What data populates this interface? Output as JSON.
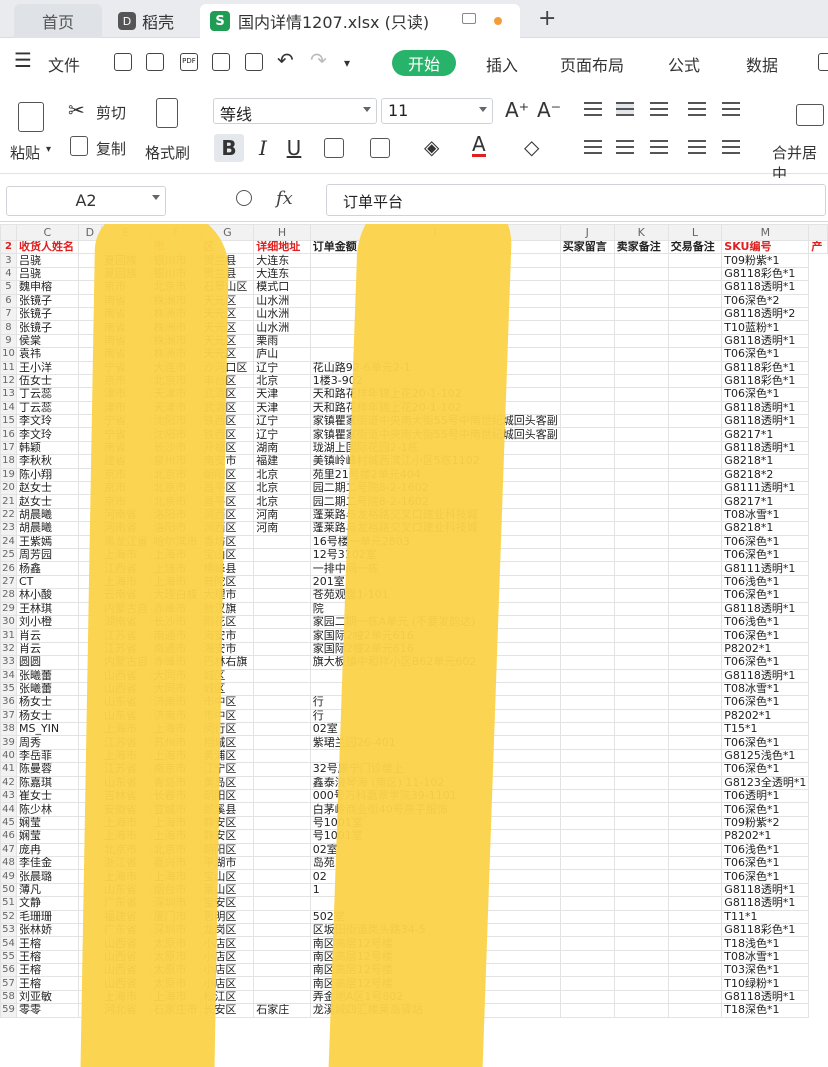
{
  "tabs": {
    "home": "首页",
    "docer": "稻壳",
    "file": "国内详情1207.xlsx (只读)",
    "new": "+"
  },
  "menu": {
    "file": "文件",
    "start": "开始",
    "insert": "插入",
    "layout": "页面布局",
    "formula": "公式",
    "data": "数据"
  },
  "ribbon": {
    "cut": "剪切",
    "copy": "复制",
    "paste": "粘贴",
    "format_painter": "格式刷",
    "font": "等线",
    "size": "11",
    "merge": "合并居中",
    "bold": "B",
    "italic": "I",
    "underline": "U"
  },
  "formula": {
    "cell": "A2",
    "fx": "fx",
    "value": "订单平台"
  },
  "columns": [
    "C",
    "D",
    "E",
    "F",
    "G",
    "H",
    "I",
    "J",
    "K",
    "L",
    "M",
    ""
  ],
  "header": [
    "收货人姓名",
    "",
    "",
    "市",
    "区",
    "详细地址",
    "订单金额",
    "买家留言",
    "卖家备注",
    "交易备注",
    "SKU编号",
    "产"
  ],
  "rows": [
    [
      "3",
      "吕骁",
      "",
      "夏回族",
      "银川市",
      "贺兰县",
      "大连东",
      "",
      "",
      "",
      "",
      "T09粉紫*1"
    ],
    [
      "4",
      "吕骁",
      "",
      "夏回族",
      "银川市",
      "贺兰县",
      "大连东",
      "",
      "",
      "",
      "",
      "G8118彩色*1"
    ],
    [
      "5",
      "魏申榕",
      "",
      "京市",
      "北京市",
      "石景山区",
      "模式口",
      "",
      "",
      "",
      "",
      "G8118透明*1"
    ],
    [
      "6",
      "张镜子",
      "",
      "南省",
      "株洲市",
      "天元区",
      "山水洲",
      "",
      "",
      "",
      "",
      "T06深色*2"
    ],
    [
      "7",
      "张镜子",
      "",
      "南省",
      "株洲市",
      "天元区",
      "山水洲",
      "",
      "",
      "",
      "",
      "G8118透明*2"
    ],
    [
      "8",
      "张镜子",
      "",
      "南省",
      "株洲市",
      "天元区",
      "山水洲",
      "",
      "",
      "",
      "",
      "T10蓝粉*1"
    ],
    [
      "9",
      "侯棠",
      "",
      "南省",
      "株洲市",
      "天元区",
      "栗雨",
      "",
      "",
      "",
      "",
      "G8118透明*1"
    ],
    [
      "10",
      "袁祎",
      "",
      "南省",
      "株洲市",
      "天元区",
      "庐山",
      "",
      "",
      "",
      "",
      "T06深色*1"
    ],
    [
      "11",
      "王小洋",
      "",
      "宁省",
      "大连市",
      "沙河口区",
      "辽宁",
      "花山路92-6单元2-1",
      "",
      "",
      "",
      "G8118彩色*1"
    ],
    [
      "12",
      "伍女士",
      "",
      "京市",
      "北京市",
      "丰台区",
      "北京",
      "1楼3-902",
      "",
      "",
      "",
      "G8118彩色*1"
    ],
    [
      "13",
      "丁云蕊",
      "",
      "津市",
      "天津市",
      "武清区",
      "天津",
      "天和路花样年锦上花20-1-102",
      "",
      "",
      "",
      "T06深色*1"
    ],
    [
      "14",
      "丁云蕊",
      "",
      "津市",
      "天津市",
      "武清区",
      "天津",
      "天和路花样年锦上花20-1-102",
      "",
      "",
      "",
      "G8118透明*1"
    ],
    [
      "15",
      "李文玲",
      "",
      "宁省",
      "沈阳市",
      "铁西区",
      "辽宁",
      "家镇瞿家街道中央南大街55号中南世纪城回头客副",
      "",
      "",
      "",
      "G8118透明*1"
    ],
    [
      "16",
      "李文玲",
      "",
      "宁省",
      "沈阳市",
      "铁西区",
      "辽宁",
      "家镇瞿家街道中央南大街55号中南世纪城回头客副",
      "",
      "",
      "",
      "G8217*1"
    ],
    [
      "17",
      "韩颖",
      "",
      "南省",
      "长沙市",
      "开福区",
      "湖南",
      "珑湖上国际花园2-1栋",
      "",
      "",
      "",
      "G8118透明*1"
    ],
    [
      "18",
      "李秋秋",
      "",
      "建省",
      "泉州市",
      "南安市",
      "福建",
      "美镇岭峰村城西滨江小区5栋1102",
      "",
      "",
      "",
      "G8218*1"
    ],
    [
      "19",
      "陈小翔",
      "",
      "京市",
      "北京市",
      "朝阳区",
      "北京",
      "苑里21号楼2单元404",
      "",
      "",
      "",
      "G8218*2"
    ],
    [
      "20",
      "赵女士",
      "",
      "京市",
      "北京市",
      "昌平区",
      "北京",
      "园二期二号院8-2-1602",
      "",
      "",
      "",
      "G8111透明*1"
    ],
    [
      "21",
      "赵女士",
      "",
      "京市",
      "北京市",
      "昌平区",
      "北京",
      "园二期二号院8-2-1602",
      "",
      "",
      "",
      "G8217*1"
    ],
    [
      "22",
      "胡晨曦",
      "",
      "河南省",
      "洛阳市",
      "涧西区",
      "河南",
      "蓬莱路与龙裕路交叉口建业科技城",
      "",
      "",
      "",
      "T08冰雪*1"
    ],
    [
      "23",
      "胡晨曦",
      "",
      "河南省",
      "洛阳市",
      "涧西区",
      "河南",
      "蓬莱路与龙裕路交叉口建业科技城",
      "",
      "",
      "",
      "G8218*1"
    ],
    [
      "24",
      "王紫嫣",
      "",
      "黑龙江省",
      "哈尔滨市",
      "香坊区",
      "",
      "16号楼一单元2803",
      "",
      "",
      "",
      "T06深色*1"
    ],
    [
      "25",
      "周芳园",
      "",
      "上海市",
      "上海市",
      "宝山区",
      "",
      "12号3102室",
      "",
      "",
      "",
      "T06深色*1"
    ],
    [
      "26",
      "杨鑫",
      "",
      "江西省",
      "上饶市",
      "横峰县",
      "",
      "一排中间一栋",
      "",
      "",
      "",
      "G8111透明*1"
    ],
    [
      "27",
      "CT",
      "",
      "上海市",
      "上海市",
      "普陀区",
      "",
      "201室",
      "",
      "",
      "",
      "T06浅色*1"
    ],
    [
      "28",
      "林小酸",
      "",
      "云南省",
      "大理白族",
      "大理市",
      "",
      "苍苑观雪1-101",
      "",
      "",
      "",
      "T06深色*1"
    ],
    [
      "29",
      "王林琪",
      "",
      "内蒙古自",
      "赤峰市",
      "敖汉旗",
      "",
      "院",
      "",
      "",
      "",
      "G8118透明*1"
    ],
    [
      "30",
      "刘小橙",
      "",
      "湖南省",
      "长沙市",
      "雨花区",
      "",
      "家园二期一栋A单元 (不要发韵达)",
      "",
      "",
      "",
      "T06浅色*1"
    ],
    [
      "31",
      "肖云",
      "",
      "江苏省",
      "南通市",
      "海安市",
      "",
      "家国际2幢2单元616",
      "",
      "",
      "",
      "T06深色*1"
    ],
    [
      "32",
      "肖云",
      "",
      "江苏省",
      "南通市",
      "海安市",
      "",
      "家国际2幢2单元616",
      "",
      "",
      "",
      "P8202*1"
    ],
    [
      "33",
      "圆圆",
      "",
      "内蒙古自",
      "赤峰市",
      "巴林右旗",
      "",
      "旗大板镇中和祥小区B62单元602",
      "",
      "",
      "",
      "T06深色*1"
    ],
    [
      "34",
      "张曦蕾",
      "",
      "山西省",
      "大同市",
      "城区",
      "",
      "",
      "",
      "",
      "",
      "G8118透明*1"
    ],
    [
      "35",
      "张曦蕾",
      "",
      "山西省",
      "大同市",
      "城区",
      "",
      "",
      "",
      "",
      "",
      "T08冰雪*1"
    ],
    [
      "36",
      "杨女士",
      "",
      "山东省",
      "济南市",
      "市中区",
      "",
      "行",
      "",
      "",
      "",
      "T06深色*1"
    ],
    [
      "37",
      "杨女士",
      "",
      "山东省",
      "济南市",
      "市中区",
      "",
      "行",
      "",
      "",
      "",
      "P8202*1"
    ],
    [
      "38",
      "MS_YIN",
      "",
      "上海市",
      "上海市",
      "闵行区",
      "",
      "02室",
      "",
      "",
      "",
      "T15*1"
    ],
    [
      "39",
      "周秀",
      "",
      "江苏省",
      "苏州市",
      "相城区",
      "",
      "紫珺兰园26-401",
      "",
      "",
      "",
      "T06深色*1"
    ],
    [
      "40",
      "李岳菲",
      "",
      "上海市",
      "上海市",
      "黄浦区",
      "",
      "",
      "",
      "",
      "",
      "G8125浅色*1"
    ],
    [
      "41",
      "陈曼蓉",
      "",
      "江苏省",
      "南京市",
      "江宁区",
      "",
      "32号康宁门诊楼上",
      "",
      "",
      "",
      "T06深色*1"
    ],
    [
      "42",
      "陈嘉琪",
      "",
      "山东省",
      "青岛市",
      "黄岛区",
      "",
      "鑫泰浪琴海 (南区) 11-102",
      "",
      "",
      "",
      "G8123全透明*1"
    ],
    [
      "43",
      "崔女士",
      "",
      "吉林省",
      "长春市",
      "朝阳区",
      "",
      "000号万科嘉翠学院39-1101",
      "",
      "",
      "",
      "T06透明*1"
    ],
    [
      "44",
      "陈少林",
      "",
      "安徽省",
      "宣城市",
      "郎溪县",
      "",
      "白茅岭商业街40号燕子服饰",
      "",
      "",
      "",
      "T06深色*1"
    ],
    [
      "45",
      "娴莹",
      "",
      "上海市",
      "上海市",
      "静安区",
      "",
      "号1001室",
      "",
      "",
      "",
      "T09粉紫*2"
    ],
    [
      "46",
      "娴莹",
      "",
      "上海市",
      "上海市",
      "静安区",
      "",
      "号1001室",
      "",
      "",
      "",
      "P8202*1"
    ],
    [
      "47",
      "庞冉",
      "",
      "北京市",
      "北京市",
      "朝阳区",
      "",
      "02室",
      "",
      "",
      "",
      "T06浅色*1"
    ],
    [
      "48",
      "李佳金",
      "",
      "浙江省",
      "嘉兴市",
      "平湖市",
      "",
      "岛苑",
      "",
      "",
      "",
      "T06深色*1"
    ],
    [
      "49",
      "张晨璐",
      "",
      "上海市",
      "上海市",
      "宝山区",
      "",
      "02",
      "",
      "",
      "",
      "T06深色*1"
    ],
    [
      "50",
      "薄凡",
      "",
      "山东省",
      "烟台市",
      "莱山区",
      "",
      "1",
      "",
      "",
      "",
      "G8118透明*1"
    ],
    [
      "51",
      "文静",
      "",
      "广东省",
      "深圳市",
      "宝安区",
      "",
      "",
      "",
      "",
      "",
      "G8118透明*1"
    ],
    [
      "52",
      "毛珊珊",
      "",
      "福建省",
      "厦门市",
      "思明区",
      "",
      "502室",
      "",
      "",
      "",
      "T11*1"
    ],
    [
      "53",
      "张林娇",
      "",
      "广东省",
      "深圳市",
      "龙岗区",
      "",
      "区坂田街道岗头路34-5",
      "",
      "",
      "",
      "G8118彩色*1"
    ],
    [
      "54",
      "王榕",
      "",
      "山西省",
      "太原市",
      "小店区",
      "",
      "南区高层12号楼",
      "",
      "",
      "",
      "T18浅色*1"
    ],
    [
      "55",
      "王榕",
      "",
      "山西省",
      "太原市",
      "小店区",
      "",
      "南区高层12号楼",
      "",
      "",
      "",
      "T08冰雪*1"
    ],
    [
      "56",
      "王榕",
      "",
      "山西省",
      "太原市",
      "小店区",
      "",
      "南区高层12号楼",
      "",
      "",
      "",
      "T03深色*1"
    ],
    [
      "57",
      "王榕",
      "",
      "山西省",
      "太原市",
      "小店区",
      "",
      "南区高层12号楼",
      "",
      "",
      "",
      "T10绿粉*1"
    ],
    [
      "58",
      "刘亚敏",
      "",
      "上海市",
      "上海市",
      "松江区",
      "",
      "弄金地A区1号802",
      "",
      "",
      "",
      "G8118透明*1"
    ],
    [
      "59",
      "零零",
      "",
      "河北省",
      "石家庄市",
      "长安区",
      "石家庄",
      "龙溪城四汇楼莱岛驿站",
      "",
      "",
      "",
      "T18深色*1"
    ]
  ]
}
